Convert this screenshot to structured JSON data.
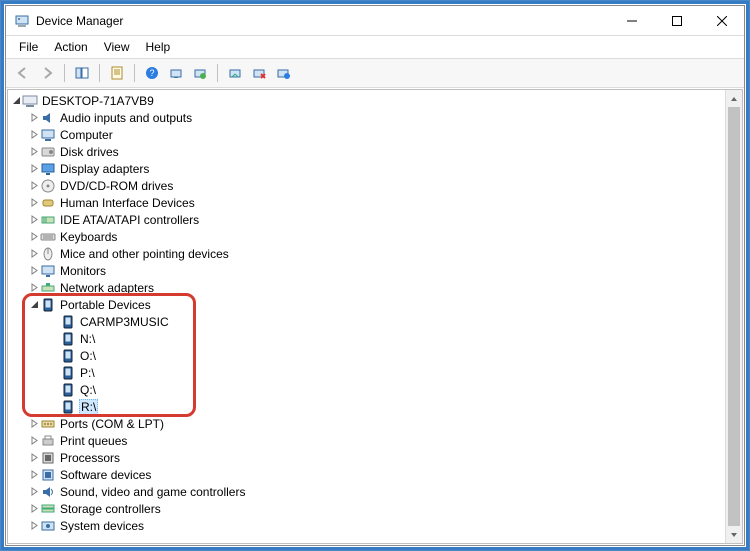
{
  "window": {
    "title": "Device Manager"
  },
  "menubar": [
    "File",
    "Action",
    "View",
    "Help"
  ],
  "root": {
    "label": "DESKTOP-71A7VB9"
  },
  "categories": [
    {
      "label": "Audio inputs and outputs",
      "icon": "audio"
    },
    {
      "label": "Computer",
      "icon": "computer"
    },
    {
      "label": "Disk drives",
      "icon": "disk"
    },
    {
      "label": "Display adapters",
      "icon": "display"
    },
    {
      "label": "DVD/CD-ROM drives",
      "icon": "cd"
    },
    {
      "label": "Human Interface Devices",
      "icon": "hid"
    },
    {
      "label": "IDE ATA/ATAPI controllers",
      "icon": "ide"
    },
    {
      "label": "Keyboards",
      "icon": "keyboard"
    },
    {
      "label": "Mice and other pointing devices",
      "icon": "mouse"
    },
    {
      "label": "Monitors",
      "icon": "monitor"
    },
    {
      "label": "Network adapters",
      "icon": "network"
    },
    {
      "label": "Portable Devices",
      "icon": "portable",
      "expanded": true,
      "children": [
        {
          "label": "CARMP3MUSIC"
        },
        {
          "label": "N:\\"
        },
        {
          "label": "O:\\"
        },
        {
          "label": "P:\\"
        },
        {
          "label": "Q:\\"
        },
        {
          "label": "R:\\",
          "selected": true
        }
      ]
    },
    {
      "label": "Ports (COM & LPT)",
      "icon": "port"
    },
    {
      "label": "Print queues",
      "icon": "printer"
    },
    {
      "label": "Processors",
      "icon": "cpu"
    },
    {
      "label": "Software devices",
      "icon": "software"
    },
    {
      "label": "Sound, video and game controllers",
      "icon": "sound"
    },
    {
      "label": "Storage controllers",
      "icon": "storage"
    },
    {
      "label": "System devices",
      "icon": "system"
    }
  ]
}
